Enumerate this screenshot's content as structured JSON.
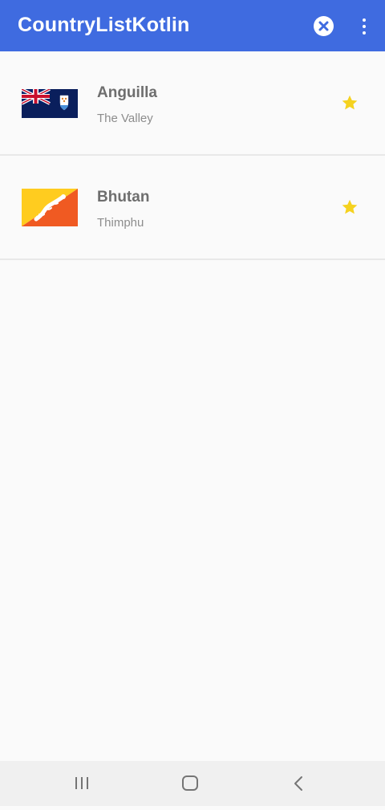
{
  "app_bar": {
    "title": "CountryListKotlin",
    "background": "#3f6be0",
    "actions": [
      {
        "icon": "clear-circle-icon"
      },
      {
        "icon": "more-vert-icon"
      }
    ]
  },
  "countries": [
    {
      "name": "Anguilla",
      "capital": "The Valley",
      "flag_icon": "anguilla-flag-icon",
      "favorite": true
    },
    {
      "name": "Bhutan",
      "capital": "Thimphu",
      "flag_icon": "bhutan-flag-icon",
      "favorite": true
    }
  ],
  "colors": {
    "accent": "#3f6be0",
    "star": "#f5d21f",
    "background": "#fafafa"
  },
  "nav_bar": {
    "buttons": [
      {
        "icon": "recents-icon"
      },
      {
        "icon": "home-icon"
      },
      {
        "icon": "back-icon"
      }
    ]
  }
}
